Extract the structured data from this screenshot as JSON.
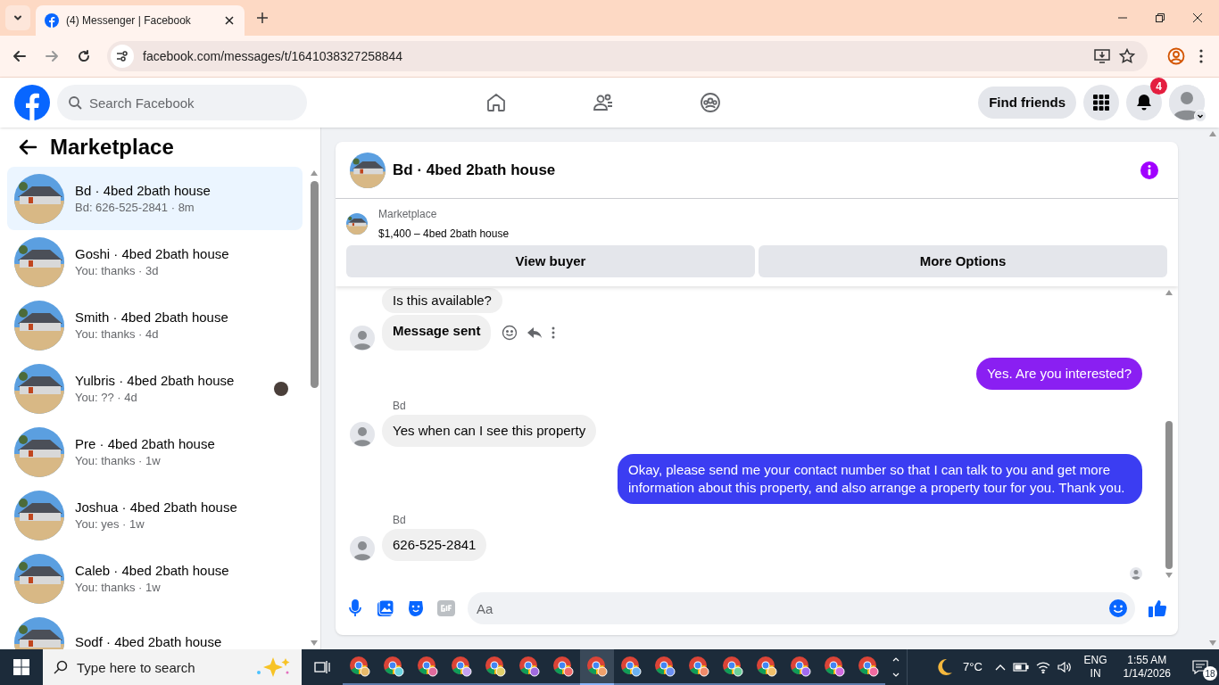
{
  "browser": {
    "tabs": [
      {
        "title": "(4) Messenger | Facebook",
        "selected": true
      }
    ],
    "url": "facebook.com/messages/t/1641038327258844"
  },
  "header": {
    "search_placeholder": "Search Facebook",
    "nav": [
      {
        "kind": "home",
        "selected": false
      },
      {
        "kind": "friends",
        "selected": false
      },
      {
        "kind": "groups",
        "selected": false
      }
    ],
    "find_friends": "Find friends",
    "notification_count": "4"
  },
  "sidebar": {
    "title": "Marketplace",
    "conversations": [
      {
        "name": "Bd · 4bed 2bath house",
        "preview": "Bd: 626-525-2841 · 8m",
        "selected": true,
        "seen": false
      },
      {
        "name": "Goshi · 4bed 2bath house",
        "preview": "You: thanks · 3d",
        "selected": false,
        "seen": false
      },
      {
        "name": "Smith · 4bed 2bath house",
        "preview": "You: thanks · 4d",
        "selected": false,
        "seen": false
      },
      {
        "name": "Yulbris · 4bed 2bath house",
        "preview": "You: ?? · 4d",
        "selected": false,
        "seen": true
      },
      {
        "name": "Pre · 4bed 2bath house",
        "preview": "You: thanks · 1w",
        "selected": false,
        "seen": false
      },
      {
        "name": "Joshua · 4bed 2bath house",
        "preview": "You: yes · 1w",
        "selected": false,
        "seen": false
      },
      {
        "name": "Caleb · 4bed 2bath house",
        "preview": "You: thanks · 1w",
        "selected": false,
        "seen": false
      },
      {
        "name": "Sodf · 4bed 2bath house",
        "selected": false,
        "seen": false
      }
    ]
  },
  "chat": {
    "title": "Bd · 4bed 2bath house",
    "listing": {
      "label": "Marketplace",
      "text": "$1,400 – 4bed 2bath house"
    },
    "buttons": [
      "View buyer",
      "More Options"
    ],
    "messages": [
      {
        "kind": "incoming",
        "text": "Is this available?",
        "avatar": false,
        "actions": false
      },
      {
        "kind": "incoming",
        "text": "Message sent",
        "avatar": true,
        "actions": true
      },
      {
        "kind": "outgoing",
        "text": "Yes. Are you interested?",
        "color": "#8a1ff2"
      },
      {
        "kind": "incoming",
        "sender": "Bd",
        "text": "Yes when can I see this property",
        "avatar": true,
        "actions": false
      },
      {
        "kind": "outgoing",
        "text": "Okay, please send me your contact number so that I can talk to you and get more information about this property, and also arrange a property tour for you. Thank you.",
        "color": "#3b3df2"
      },
      {
        "kind": "incoming",
        "sender": "Bd",
        "text": "626-525-2841",
        "avatar": true,
        "actions": false
      }
    ],
    "composer_placeholder": "Aa"
  },
  "taskbar": {
    "search_placeholder": "Type here to search",
    "apps": [
      {
        "selected": false
      },
      {
        "selected": false
      },
      {
        "selected": false
      },
      {
        "selected": false
      },
      {
        "selected": false
      },
      {
        "selected": false
      },
      {
        "selected": false
      },
      {
        "selected": true
      },
      {
        "selected": false
      },
      {
        "selected": false
      },
      {
        "selected": false
      },
      {
        "selected": false
      },
      {
        "selected": false
      },
      {
        "selected": false
      },
      {
        "selected": false
      },
      {
        "selected": false
      }
    ],
    "temperature": "7°C",
    "language": "ENG",
    "region": "IN",
    "time": "1:55 AM",
    "date": "1/14/2026",
    "notifications": "18"
  }
}
